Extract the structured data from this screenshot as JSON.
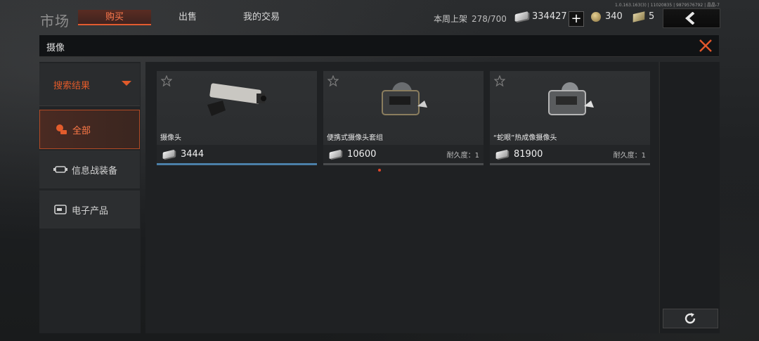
{
  "version": "1.0.163.163(3) | 11020835 | 9879576792 | 晶晶-7",
  "header": {
    "title": "市场",
    "tabs": [
      {
        "label": "购买",
        "active": true
      },
      {
        "label": "出售",
        "active": false
      },
      {
        "label": "我的交易",
        "active": false
      }
    ],
    "weekly_listing_label": "本周上架",
    "weekly_listing_value": "278/700",
    "cash": "334427",
    "coins": "340",
    "vouchers": "5"
  },
  "search": {
    "query": "摄像"
  },
  "sidebar": {
    "filter_label": "搜索结果",
    "categories": [
      {
        "label": "全部",
        "icon": "coins-icon",
        "active": true
      },
      {
        "label": "信息战装备",
        "icon": "gadget-icon",
        "active": false
      },
      {
        "label": "电子产品",
        "icon": "electronics-icon",
        "active": false
      }
    ]
  },
  "items": [
    {
      "name": "摄像头",
      "price": "3444",
      "durability": "",
      "selected": true
    },
    {
      "name": "便携式摄像头套组",
      "price": "10600",
      "durability": "耐久度：1",
      "selected": false
    },
    {
      "name": "“蛇眼”热成像摄像头",
      "price": "81900",
      "durability": "耐久度：1",
      "selected": false
    }
  ],
  "colors": {
    "accent": "#e05a2a",
    "selected_bar": "#4b7fa8"
  }
}
